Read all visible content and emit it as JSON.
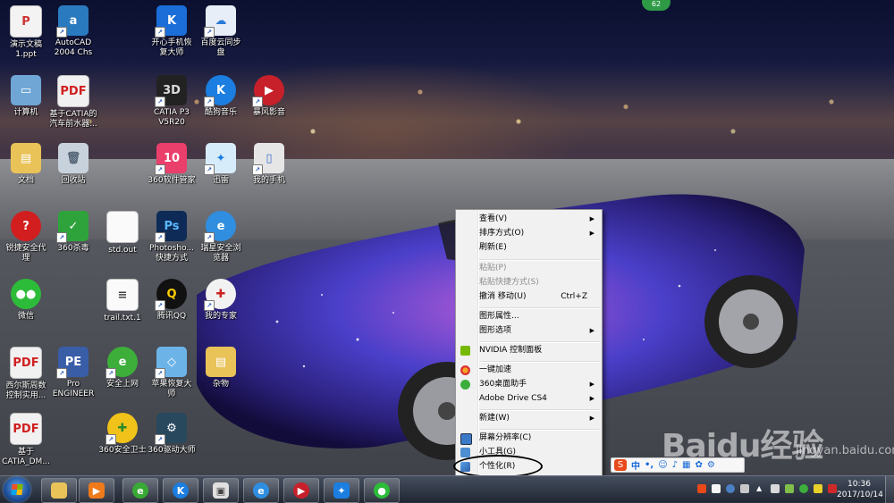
{
  "top_badge": "62",
  "desktop_icons": [
    {
      "label": "演示文稿\n1.ppt"
    },
    {
      "label": "AutoCAD\n2004 Chs"
    },
    {
      "label": "开心手机恢\n复大师"
    },
    {
      "label": "百度云同步\n盘"
    },
    {
      "label": "计算机"
    },
    {
      "label": "基于CATIA的\n汽车前水器..."
    },
    {
      "label": "CATIA P3\nV5R20"
    },
    {
      "label": "酷狗音乐"
    },
    {
      "label": "暴风影音"
    },
    {
      "label": "文档"
    },
    {
      "label": "回收站"
    },
    {
      "label": "360软件管家"
    },
    {
      "label": "迅雷"
    },
    {
      "label": "我的手机"
    },
    {
      "label": "锐捷安全代\n理"
    },
    {
      "label": "360杀毒"
    },
    {
      "label": "std.out"
    },
    {
      "label": "Photosho...\n快捷方式"
    },
    {
      "label": "瑞星安全浏\n览器"
    },
    {
      "label": "微信"
    },
    {
      "label": "trail.txt.1"
    },
    {
      "label": "腾讯QQ"
    },
    {
      "label": "我的专家"
    },
    {
      "label": "西尔斯周数\n控制实用..."
    },
    {
      "label": "Pro\nENGINEER"
    },
    {
      "label": "安全上网"
    },
    {
      "label": "苹果恢复大\n师"
    },
    {
      "label": "杂物"
    },
    {
      "label": "基于\nCATIA_DM..."
    },
    {
      "label": "360安全卫士"
    },
    {
      "label": "360驱动大师"
    }
  ],
  "context_menu": {
    "items": [
      {
        "label": "查看(V)",
        "submenu": "▶"
      },
      {
        "label": "排序方式(O)",
        "submenu": "▶"
      },
      {
        "label": "刷新(E)"
      },
      {
        "label": "粘贴(P)"
      },
      {
        "label": "粘贴快捷方式(S)"
      },
      {
        "label": "撤消 移动(U)",
        "accel": "Ctrl+Z"
      },
      {
        "label": "图形属性..."
      },
      {
        "label": "图形选项",
        "submenu": "▶"
      },
      {
        "label": "NVIDIA 控制面板"
      },
      {
        "label": "一键加速"
      },
      {
        "label": "360桌面助手",
        "submenu": "▶"
      },
      {
        "label": "Adobe Drive CS4",
        "submenu": "▶"
      },
      {
        "label": "新建(W)",
        "submenu": "▶"
      },
      {
        "label": "屏幕分辨率(C)"
      },
      {
        "label": "小工具(G)"
      },
      {
        "label": "个性化(R)"
      }
    ]
  },
  "ime_bar": {
    "brand": "S",
    "lang": "中"
  },
  "taskbar": {
    "apps": [
      "explorer",
      "media-player",
      "360-browser",
      "kugou",
      "photo-viewer",
      "ie-browser",
      "baofeng",
      "thunder",
      "wechat"
    ]
  },
  "clock": {
    "time": "10:36",
    "date": "2017/10/14"
  },
  "watermark": {
    "main": "Baidu经验",
    "sub": "jingyan.baidu.com"
  },
  "colors": {
    "menu_bg": "#f1f1f1",
    "taskbar_bg": "#2b3342",
    "accent": "#1769d6"
  }
}
